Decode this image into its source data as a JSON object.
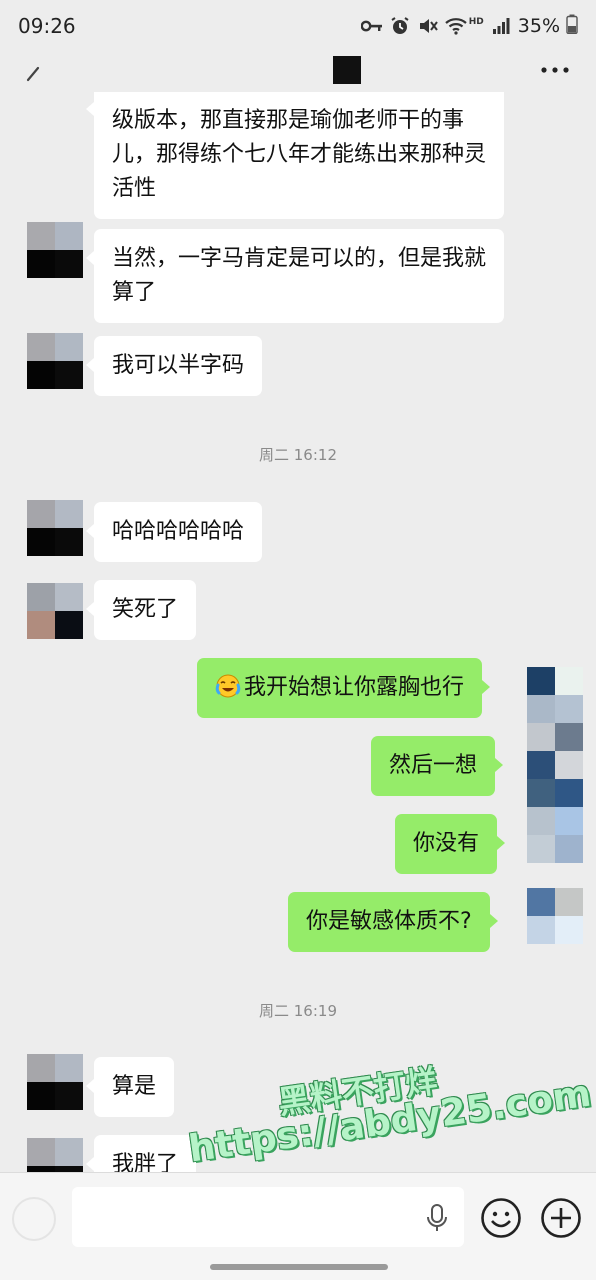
{
  "status_bar": {
    "time": "09:26",
    "battery": "35%",
    "icons": [
      "key-icon",
      "alarm-icon",
      "mute-icon",
      "wifi-icon",
      "hd-icon",
      "signal-icon",
      "battery-icon"
    ],
    "hd_label": "HD"
  },
  "nav": {
    "icons": [
      "back-icon",
      "more-icon"
    ]
  },
  "messages": [
    {
      "side": "in",
      "text": "级版本，那直接那是瑜伽老师干的事儿，那得练个七八年才能练出来那种灵活性"
    },
    {
      "side": "in",
      "text": "当然，一字马肯定是可以的，但是我就算了"
    },
    {
      "side": "in",
      "text": "我可以半字码"
    },
    {
      "type": "time",
      "text": "周二 16:12"
    },
    {
      "side": "in",
      "text": "哈哈哈哈哈哈"
    },
    {
      "side": "in",
      "text": "笑死了"
    },
    {
      "side": "out",
      "text": "我开始想让你露胸也行",
      "emoji": "laugh-cry-emoji"
    },
    {
      "side": "out",
      "text": "然后一想"
    },
    {
      "side": "out",
      "text": "你没有"
    },
    {
      "side": "out",
      "text": "你是敏感体质不?"
    },
    {
      "type": "time",
      "text": "周二 16:19"
    },
    {
      "side": "in",
      "text": "算是"
    },
    {
      "side": "in",
      "text": "我胖了"
    }
  ],
  "input": {
    "placeholder": "",
    "icons": [
      "voice-icon",
      "mic-icon",
      "emoji-icon",
      "plus-icon"
    ]
  },
  "watermark": {
    "line1": "黑料不打烊",
    "line2": "https://abdy25.com"
  },
  "colors": {
    "background": "#ededed",
    "incoming_bubble": "#ffffff",
    "outgoing_bubble": "#95ec69",
    "timestamp": "#8a8a8a"
  }
}
